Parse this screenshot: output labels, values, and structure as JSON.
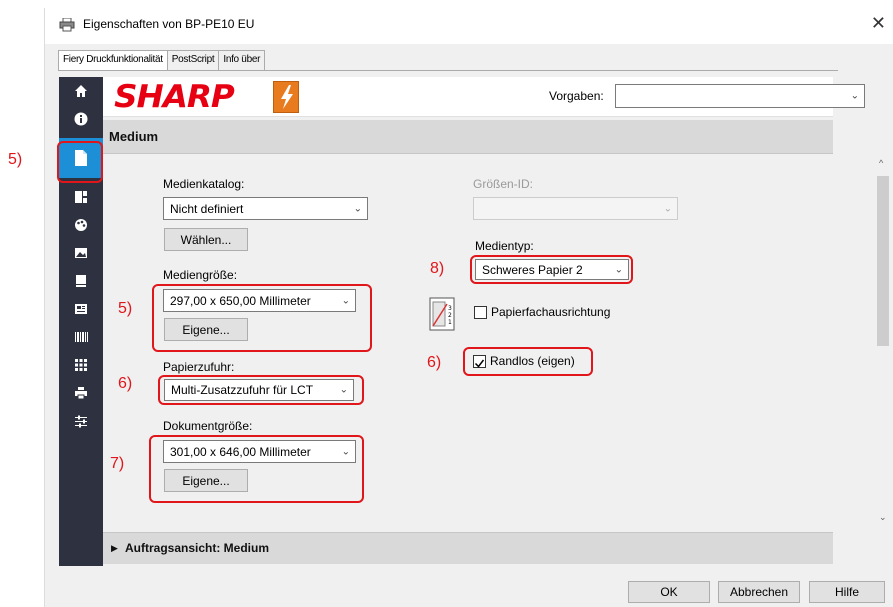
{
  "window": {
    "title": "Eigenschaften von BP-PE10 EU",
    "close_glyph": "✕"
  },
  "tabs": [
    {
      "label": "Fiery Druckfunktionalität",
      "active": true
    },
    {
      "label": "PostScript",
      "active": false
    },
    {
      "label": "Info über",
      "active": false
    }
  ],
  "sidebar": {
    "items": [
      {
        "icon": "home-icon"
      },
      {
        "icon": "info-icon"
      },
      {
        "icon": "document-icon",
        "active": true
      },
      {
        "icon": "layout-icon"
      },
      {
        "icon": "color-palette-icon"
      },
      {
        "icon": "image-icon"
      },
      {
        "icon": "book-icon"
      },
      {
        "icon": "stamp-icon"
      },
      {
        "icon": "barcode-icon"
      },
      {
        "icon": "grid-icon"
      },
      {
        "icon": "printer-icon"
      },
      {
        "icon": "sliders-icon"
      }
    ]
  },
  "logo": {
    "brand": "SHARP",
    "fiery_icon": "fiery-logo-icon"
  },
  "vorgaben": {
    "label": "Vorgaben:",
    "value": ""
  },
  "section": {
    "title": "Medium"
  },
  "form": {
    "medienkatalog_label": "Medienkatalog:",
    "medienkatalog_value": "Nicht definiert",
    "waehlen_button": "Wählen...",
    "mediengroesse_label": "Mediengröße:",
    "mediengroesse_value": "297,00 x 650,00 Millimeter",
    "eigene_button_1": "Eigene...",
    "papierzufuhr_label": "Papierzufuhr:",
    "papierzufuhr_value": "Multi-Zusatzzufuhr für LCT",
    "dokumentgroesse_label": "Dokumentgröße:",
    "dokumentgroesse_value": "301,00 x 646,00 Millimeter",
    "eigene_button_2": "Eigene...",
    "groessen_id_label": "Größen-ID:",
    "groessen_id_value": "",
    "medientyp_label": "Medientyp:",
    "medientyp_value": "Schweres Papier 2",
    "papierfach_label": "Papierfachausrichtung",
    "papierfach_checked": false,
    "randlos_label": "Randlos (eigen)",
    "randlos_checked": true
  },
  "annotations": {
    "a5_sidebar": "5)",
    "a5_size": "5)",
    "a6_feed": "6)",
    "a7_doc": "7)",
    "a8_type": "8)",
    "a6_borderless": "6)",
    "color": "#e0161b"
  },
  "footer": {
    "auftragsansicht": "Auftragsansicht: Medium"
  },
  "buttons": {
    "ok": "OK",
    "abbrechen": "Abbrechen",
    "hilfe": "Hilfe"
  },
  "colors": {
    "sidebar_bg": "#2e3240",
    "sidebar_active": "#1c8fd6",
    "brand_red": "#e60012",
    "fiery_orange": "#e87b1e"
  }
}
